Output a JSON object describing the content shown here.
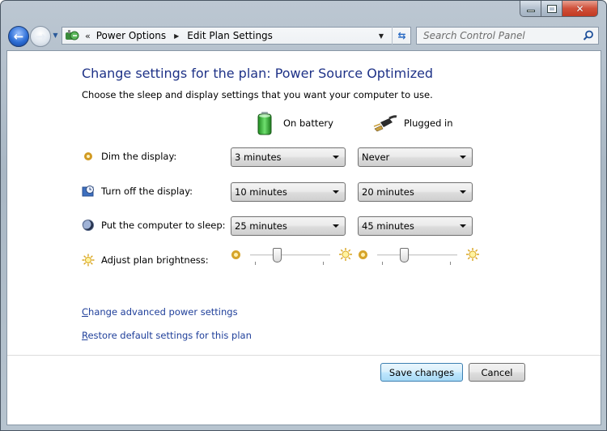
{
  "window": {
    "caption_buttons": {
      "minimize": "minimize",
      "maximize": "maximize",
      "close": "close"
    }
  },
  "navigation": {
    "back_icon": "back-arrow-icon",
    "forward_icon": "forward-arrow-icon",
    "recent_pages_icon": "chevron-down-icon"
  },
  "address_bar": {
    "overflow_chevron": "«",
    "breadcrumb": [
      "Power Options",
      "Edit Plan Settings"
    ],
    "separator": "▶"
  },
  "search": {
    "placeholder": "Search Control Panel",
    "value": ""
  },
  "main": {
    "title": "Change settings for the plan: Power Source Optimized",
    "subtitle": "Choose the sleep and display settings that you want your computer to use.",
    "columns": [
      {
        "label": "On battery",
        "icon": "battery-icon"
      },
      {
        "label": "Plugged in",
        "icon": "power-plug-icon"
      }
    ],
    "settings": [
      {
        "label": "Dim the display:",
        "icon": "dim-display-icon",
        "on_battery": "3 minutes",
        "plugged_in": "Never"
      },
      {
        "label": "Turn off the display:",
        "icon": "display-off-icon",
        "on_battery": "10 minutes",
        "plugged_in": "20 minutes"
      },
      {
        "label": "Put the computer to sleep:",
        "icon": "sleep-moon-icon",
        "on_battery": "25 minutes",
        "plugged_in": "45 minutes"
      }
    ],
    "brightness": {
      "label": "Adjust plan brightness:",
      "on_battery_level": 0.33,
      "plugged_in_level": 0.33
    },
    "links": [
      {
        "label": "Change advanced power settings",
        "accesskey": "C"
      },
      {
        "label": "Restore default settings for this plan",
        "accesskey": "R"
      }
    ]
  },
  "footer": {
    "save_label": "Save changes",
    "cancel_label": "Cancel"
  }
}
